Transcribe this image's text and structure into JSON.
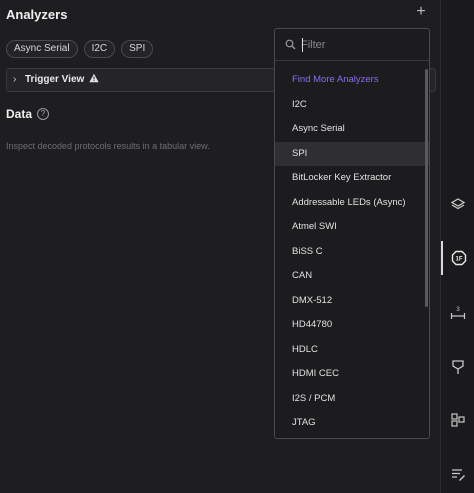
{
  "header": {
    "title": "Analyzers",
    "add_icon": "plus-icon"
  },
  "chips": [
    "Async Serial",
    "I2C",
    "SPI"
  ],
  "trigger": {
    "label": "Trigger View",
    "icon": "warning-icon"
  },
  "data_section": {
    "title": "Data",
    "help": "?",
    "description": "Inspect decoded protocols results in a tabular view."
  },
  "dropdown": {
    "placeholder": "Filter",
    "items": [
      {
        "label": "Find More Analyzers",
        "accent": true
      },
      {
        "label": "I2C"
      },
      {
        "label": "Async Serial"
      },
      {
        "label": "SPI",
        "selected": true
      },
      {
        "label": "BitLocker Key Extractor"
      },
      {
        "label": "Addressable LEDs (Async)"
      },
      {
        "label": "Atmel SWI"
      },
      {
        "label": "BiSS C"
      },
      {
        "label": "CAN"
      },
      {
        "label": "DMX-512"
      },
      {
        "label": "HD44780"
      },
      {
        "label": "HDLC"
      },
      {
        "label": "HDMI CEC"
      },
      {
        "label": "I2S / PCM"
      },
      {
        "label": "JTAG"
      }
    ]
  },
  "rail": {
    "items": [
      "layers-icon",
      "analyzers-icon",
      "timing-icon",
      "extension-icon",
      "grid-icon",
      "notes-icon"
    ],
    "active": "analyzers-icon",
    "timing_badge": "3"
  },
  "colors": {
    "accent": "#8b6cf0",
    "background": "#1e1e20"
  }
}
